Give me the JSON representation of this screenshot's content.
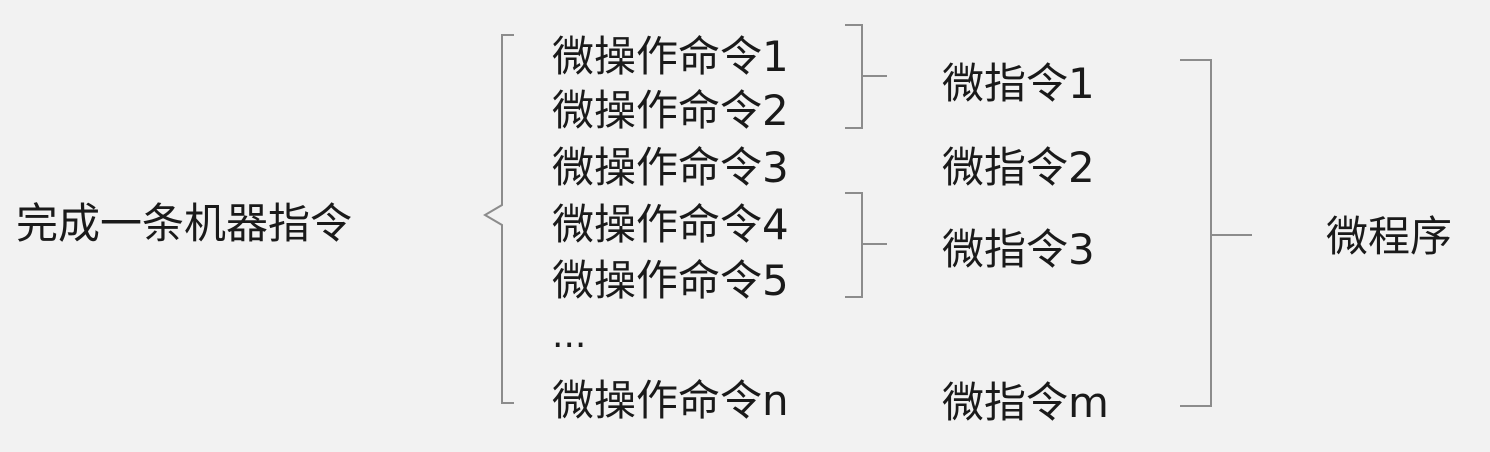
{
  "diagram": {
    "left_label": "完成一条机器指令",
    "micro_operations": [
      "微操作命令1",
      "微操作命令2",
      "微操作命令3",
      "微操作命令4",
      "微操作命令5",
      "...",
      "微操作命令n"
    ],
    "micro_instructions": [
      "微指令1",
      "微指令2",
      "微指令3",
      "微指令m"
    ],
    "right_label": "微程序"
  },
  "colors": {
    "background": "#f2f2f2",
    "text": "#1a1a1a",
    "bracket": "#8c8c8c"
  }
}
